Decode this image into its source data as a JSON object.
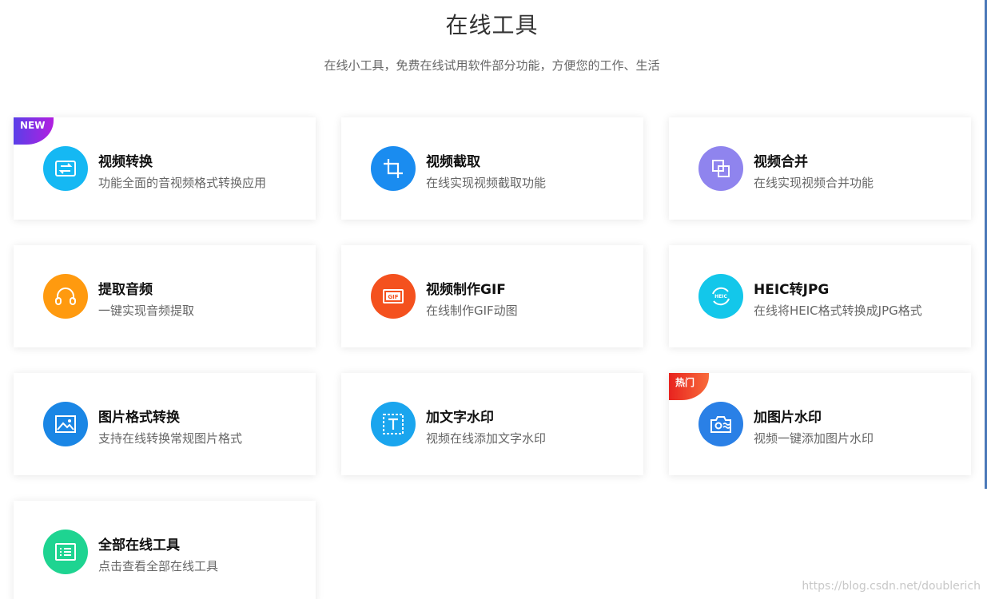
{
  "header": {
    "title": "在线工具",
    "subtitle": "在线小工具，免费在线试用软件部分功能，方便您的工作、生活"
  },
  "cards": [
    {
      "title": "视频转换",
      "desc": "功能全面的音视频格式转换应用",
      "icon": "swap-icon",
      "color": "#15b8f3",
      "badge": "NEW"
    },
    {
      "title": "视频截取",
      "desc": "在线实现视频截取功能",
      "icon": "crop-icon",
      "color": "#1a8cf0"
    },
    {
      "title": "视频合并",
      "desc": "在线实现视频合并功能",
      "icon": "merge-icon",
      "color": "#8f84ee"
    },
    {
      "title": "提取音频",
      "desc": "一键实现音频提取",
      "icon": "headphones-icon",
      "color": "#ff9a0f"
    },
    {
      "title": "视频制作GIF",
      "desc": "在线制作GIF动图",
      "icon": "gif-icon",
      "color": "#f4511e"
    },
    {
      "title": "HEIC转JPG",
      "desc": "在线将HEIC格式转换成JPG格式",
      "icon": "heic-icon",
      "color": "#13c7ea",
      "icon_text": "HEIC"
    },
    {
      "title": "图片格式转换",
      "desc": "支持在线转换常规图片格式",
      "icon": "image-icon",
      "color": "#1a86e5"
    },
    {
      "title": "加文字水印",
      "desc": "视频在线添加文字水印",
      "icon": "text-watermark-icon",
      "color": "#1aa5ee"
    },
    {
      "title": "加图片水印",
      "desc": "视频一键添加图片水印",
      "icon": "camera-watermark-icon",
      "color": "#2a80e6",
      "badge": "热门"
    },
    {
      "title": "全部在线工具",
      "desc": "点击查看全部在线工具",
      "icon": "list-icon",
      "color": "#1ed491"
    }
  ],
  "watermark": "https://blog.csdn.net/doublerich"
}
